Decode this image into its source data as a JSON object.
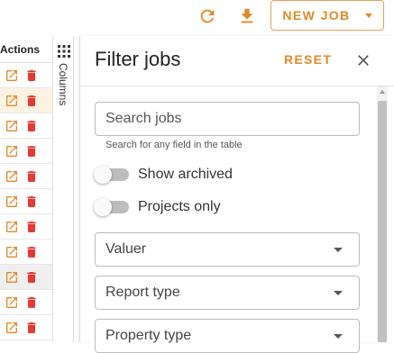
{
  "toolbar": {
    "refresh_icon": "refresh-icon",
    "download_icon": "download-icon",
    "new_job_label": "NEW JOB",
    "accent_color": "#e08a2a"
  },
  "table": {
    "actions_header": "Actions",
    "rows": [
      {
        "state": "normal"
      },
      {
        "state": "highlight"
      },
      {
        "state": "normal"
      },
      {
        "state": "normal"
      },
      {
        "state": "normal"
      },
      {
        "state": "normal"
      },
      {
        "state": "normal"
      },
      {
        "state": "normal"
      },
      {
        "state": "grey"
      },
      {
        "state": "normal"
      },
      {
        "state": "normal"
      }
    ],
    "edit_icon": "open-in-new-icon",
    "delete_icon": "trash-icon",
    "delete_color": "#e53935"
  },
  "columns_toggle": {
    "label": "Columns",
    "icon": "grid-icon"
  },
  "filter_panel": {
    "title": "Filter jobs",
    "reset_label": "RESET",
    "close_icon": "close-icon",
    "search": {
      "placeholder": "Search jobs",
      "value": "",
      "helper": "Search for any field in the table"
    },
    "toggles": [
      {
        "label": "Show archived",
        "checked": false
      },
      {
        "label": "Projects only",
        "checked": false
      }
    ],
    "selects": [
      {
        "label": "Valuer"
      },
      {
        "label": "Report type"
      },
      {
        "label": "Property type"
      }
    ]
  }
}
